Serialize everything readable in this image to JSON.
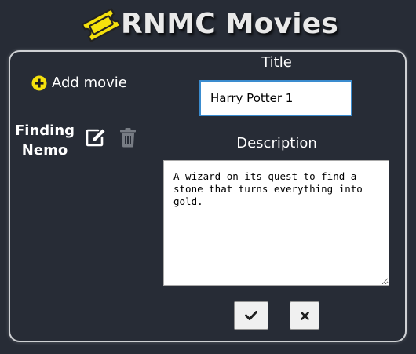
{
  "app": {
    "title": "RNMC Movies",
    "logo_icon": "ticket-icon",
    "colors": {
      "background": "#272c36",
      "accent_yellow": "#f5e10d",
      "title_text": "#e9e9e9",
      "input_focus_border": "#3a8ccf"
    }
  },
  "sidebar": {
    "add_movie_label": "Add movie",
    "add_icon": "plus-circle-icon",
    "movies": [
      {
        "title": "Finding Nemo",
        "edit_icon": "edit-icon",
        "delete_icon": "trash-icon"
      }
    ]
  },
  "form": {
    "title_label": "Title",
    "title_value": "Harry Potter 1",
    "description_label": "Description",
    "description_value": "A wizard on its quest to find a stone that turns everything into gold.",
    "save_icon": "check-icon",
    "cancel_icon": "close-icon"
  }
}
